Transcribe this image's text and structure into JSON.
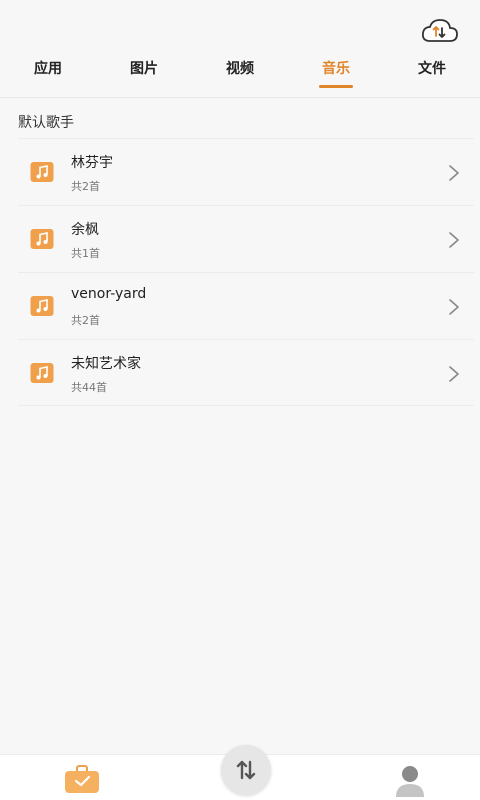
{
  "header": {
    "cloud_icon": "cloud-transfer-icon"
  },
  "tabs": [
    {
      "label": "应用",
      "active": false
    },
    {
      "label": "图片",
      "active": false
    },
    {
      "label": "视频",
      "active": false
    },
    {
      "label": "音乐",
      "active": true
    },
    {
      "label": "文件",
      "active": false
    }
  ],
  "section": {
    "title": "默认歌手"
  },
  "artists": [
    {
      "name": "林芬宇",
      "count": "共2首",
      "icon": "music-note-icon"
    },
    {
      "name": "余枫",
      "count": "共1首",
      "icon": "music-note-icon"
    },
    {
      "name": "venor-yard",
      "count": "共2首",
      "icon": "music-note-icon"
    },
    {
      "name": "未知艺术家",
      "count": "共44首",
      "icon": "music-note-icon"
    }
  ],
  "bottom_nav": {
    "items": [
      {
        "icon": "briefcase-icon"
      },
      {
        "icon": "transfer-arrows-icon"
      },
      {
        "icon": "user-icon"
      }
    ]
  },
  "colors": {
    "accent": "#e0852a",
    "icon_orange": "#f0a04b",
    "background": "#f7f7f7"
  }
}
